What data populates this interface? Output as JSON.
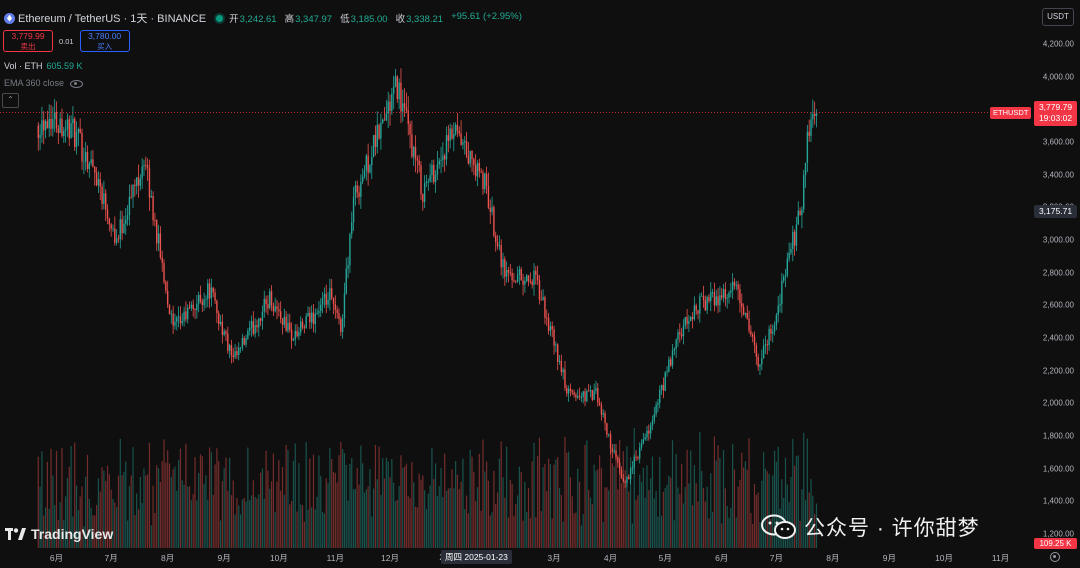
{
  "header": {
    "symbol": "Ethereum / TetherUS · 1天 · BINANCE",
    "ohlc": [
      {
        "label": "开",
        "value": "3,242.61"
      },
      {
        "label": "高",
        "value": "3,347.97"
      },
      {
        "label": "低",
        "value": "3,185.00"
      },
      {
        "label": "收",
        "value": "3,338.21"
      }
    ],
    "change": "+95.61 (+2.95%)"
  },
  "trade": {
    "sell_price": "3,779.99",
    "sell_label": "卖出",
    "spread": "0.01",
    "buy_price": "3,780.00",
    "buy_label": "买入"
  },
  "indicators": {
    "volume_label": "Vol · ETH",
    "volume_value": "605.59 K",
    "ema_label": "EMA 360 close"
  },
  "collapse_icon": "chevron-up",
  "price_axis": {
    "currency": "USDT",
    "ticks": [
      "4,200.00",
      "4,000.00",
      "3,800.00",
      "3,600.00",
      "3,400.00",
      "3,200.00",
      "3,000.00",
      "2,800.00",
      "2,600.00",
      "2,400.00",
      "2,200.00",
      "2,000.00",
      "1,800.00",
      "1,600.00",
      "1,400.00",
      "1,200.00"
    ],
    "last_symbol": "ETHUSDT",
    "last_price": "3,779.79",
    "countdown": "19:03:02",
    "crosshair_price": "3,175.71",
    "volume_last": "109.25 K"
  },
  "time_axis": {
    "ticks": [
      "6月",
      "7月",
      "8月",
      "9月",
      "10月",
      "11月",
      "12月",
      "202",
      "3月",
      "4月",
      "5月",
      "6月",
      "7月",
      "8月",
      "9月",
      "10月",
      "11月"
    ],
    "crosshair_date": "周四 2025-01-23"
  },
  "branding": {
    "logo_text": "TradingView",
    "watermark": "公众号 · 许你甜梦"
  },
  "colors": {
    "up": "#26a69a",
    "down": "#ef5350",
    "background": "#0f0f0f",
    "last_price": "#f23645"
  },
  "chart_data": {
    "type": "candlestick",
    "symbol": "ETHUSDT",
    "interval": "1D",
    "y_range": [
      1150,
      4300
    ],
    "x_labels": [
      "6月",
      "7月",
      "8月",
      "9月",
      "10月",
      "11月",
      "12月",
      "2025",
      "3月",
      "4月",
      "5月",
      "6月",
      "7月",
      "8月",
      "9月",
      "10月",
      "11月"
    ],
    "anchors": [
      {
        "date": "2024-05-22",
        "close": 3700
      },
      {
        "date": "2024-05-29",
        "close": 3760
      },
      {
        "date": "2024-06-10",
        "close": 3680
      },
      {
        "date": "2024-06-24",
        "close": 3400
      },
      {
        "date": "2024-07-05",
        "close": 3000
      },
      {
        "date": "2024-07-20",
        "close": 3500
      },
      {
        "date": "2024-08-05",
        "close": 2450
      },
      {
        "date": "2024-08-25",
        "close": 2700
      },
      {
        "date": "2024-09-07",
        "close": 2250
      },
      {
        "date": "2024-09-27",
        "close": 2650
      },
      {
        "date": "2024-10-10",
        "close": 2400
      },
      {
        "date": "2024-10-30",
        "close": 2650
      },
      {
        "date": "2024-11-05",
        "close": 2450
      },
      {
        "date": "2024-11-12",
        "close": 3250
      },
      {
        "date": "2024-12-06",
        "close": 3950
      },
      {
        "date": "2024-12-20",
        "close": 3300
      },
      {
        "date": "2025-01-06",
        "close": 3650
      },
      {
        "date": "2025-01-23",
        "close": 3340
      },
      {
        "date": "2025-02-03",
        "close": 2800
      },
      {
        "date": "2025-02-20",
        "close": 2750
      },
      {
        "date": "2025-03-10",
        "close": 2050
      },
      {
        "date": "2025-03-25",
        "close": 2050
      },
      {
        "date": "2025-04-09",
        "close": 1500
      },
      {
        "date": "2025-04-22",
        "close": 1800
      },
      {
        "date": "2025-05-09",
        "close": 2400
      },
      {
        "date": "2025-05-20",
        "close": 2600
      },
      {
        "date": "2025-06-10",
        "close": 2700
      },
      {
        "date": "2025-06-22",
        "close": 2250
      },
      {
        "date": "2025-07-01",
        "close": 2500
      },
      {
        "date": "2025-07-10",
        "close": 2950
      },
      {
        "date": "2025-07-15",
        "close": 3150
      },
      {
        "date": "2025-07-20",
        "close": 3700
      },
      {
        "date": "2025-07-24",
        "close": 3779.79
      }
    ],
    "last_price": 3779.79,
    "crosshair_price": 3175.71
  }
}
